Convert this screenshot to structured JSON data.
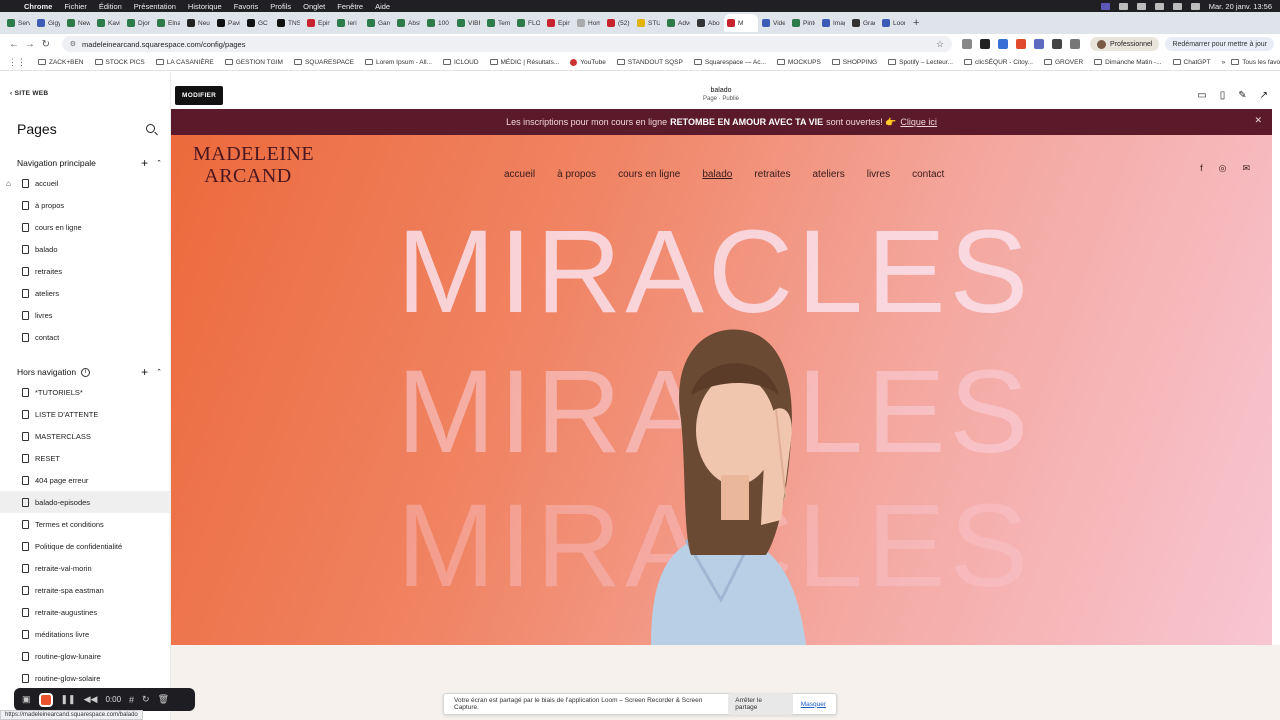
{
  "menubar": {
    "app": "Chrome",
    "items": [
      "Fichier",
      "Édition",
      "Présentation",
      "Historique",
      "Favoris",
      "Profils",
      "Onglet",
      "Fenêtre",
      "Aide"
    ],
    "clock": "Mar. 20 janv. 13:56"
  },
  "tabs": [
    {
      "label": "Servi",
      "color": "#2d7a4a"
    },
    {
      "label": "Gigy",
      "color": "#3b5bb5"
    },
    {
      "label": "New",
      "color": "#2d7a4a"
    },
    {
      "label": "Kavi",
      "color": "#2d7a4a"
    },
    {
      "label": "Djon",
      "color": "#2d7a4a"
    },
    {
      "label": "Elna",
      "color": "#2d7a4a"
    },
    {
      "label": "Neu",
      "color": "#222"
    },
    {
      "label": "Pavi",
      "color": "#111"
    },
    {
      "label": "GC",
      "color": "#111"
    },
    {
      "label": "TNS",
      "color": "#111"
    },
    {
      "label": "Épin",
      "color": "#c8232c"
    },
    {
      "label": "leri",
      "color": "#2d7a4a"
    },
    {
      "label": "Garc",
      "color": "#2d7a4a"
    },
    {
      "label": "Abst",
      "color": "#2d7a4a"
    },
    {
      "label": "100",
      "color": "#2d7a4a"
    },
    {
      "label": "VIBR",
      "color": "#2d7a4a"
    },
    {
      "label": "Tem",
      "color": "#2d7a4a"
    },
    {
      "label": "FLOI",
      "color": "#2d7a4a"
    },
    {
      "label": "Épin",
      "color": "#c8232c"
    },
    {
      "label": "Hom",
      "color": "#aaa"
    },
    {
      "label": "(52)",
      "color": "#c8232c"
    },
    {
      "label": "STU",
      "color": "#e0b400"
    },
    {
      "label": "Adve",
      "color": "#2d7a4a"
    },
    {
      "label": "Abo",
      "color": "#333"
    },
    {
      "label": "M",
      "color": "#c8232c",
      "active": true
    },
    {
      "label": "Vide",
      "color": "#3b5bb5"
    },
    {
      "label": "Pinte",
      "color": "#2d7a4a"
    },
    {
      "label": "Imag",
      "color": "#3b5bb5"
    },
    {
      "label": "Grad",
      "color": "#333"
    },
    {
      "label": "Loon",
      "color": "#3b5bb5"
    }
  ],
  "toolbar": {
    "url": "madeleinearcand.squarespace.com/config/pages",
    "profile_label": "Professionnel",
    "update_label": "Redémarrer pour mettre à jour"
  },
  "bookmarks": {
    "items": [
      "ZACK+BEN",
      "STOCK PICS",
      "LA CASANIÈRE",
      "GESTION TGIM",
      "SQUARESPACE",
      "Lorem Ipsum - All...",
      "ICLOUD",
      "MÉDIC | Résultats...",
      "YouTube",
      "STANDOUT SQSP",
      "Squarespace — Ac...",
      "MOCKUPS",
      "SHOPPING",
      "Spotify – Lecteur...",
      "clicSÉQUR - Citoy...",
      "GROVER",
      "Dimanche Matin -...",
      "ChatGPT"
    ],
    "all_label": "Tous les favoris"
  },
  "sidebar": {
    "back_label": "SITE WEB",
    "title": "Pages",
    "nav_section": "Navigation principale",
    "nav_pages": [
      "accueil",
      "à propos",
      "cours en ligne",
      "balado",
      "retraites",
      "ateliers",
      "livres",
      "contact"
    ],
    "off_section": "Hors navigation",
    "off_pages": [
      "*TUTORIELS*",
      "LISTE D'ATTENTE",
      "MASTERCLASS",
      "RESET",
      "404 page erreur",
      "balado-episodes",
      "Termes et conditions",
      "Politique de confidentialité",
      "retraite-val-morin",
      "retraite-spa eastman",
      "retraite-augustines",
      "méditations livre",
      "routine-glow-lunaire",
      "routine-glow-solaire"
    ],
    "selected": "balado-episodes"
  },
  "editor": {
    "modify_label": "MODIFIER",
    "page_name": "balado",
    "page_status": "Page · Publié"
  },
  "site": {
    "announcement_prefix": "Les inscriptions pour mon cours en ligne",
    "announcement_bold": "RETOMBE EN AMOUR AVEC TA VIE",
    "announcement_suffix": "sont ouvertes! 👉",
    "announcement_link": "Clique ici",
    "logo_line1": "MADELEINE",
    "logo_line2": "ARCAND",
    "nav": [
      "accueil",
      "à propos",
      "cours en ligne",
      "balado",
      "retraites",
      "ateliers",
      "livres",
      "contact"
    ],
    "current_nav": "balado",
    "hero_word": "MIRACLES"
  },
  "loom": {
    "timer": "0:00",
    "share_text": "Votre écran est partagé par le biais de l'application Loom – Screen Recorder & Screen Capture.",
    "stop_label": "Arrêter le partage",
    "hide_label": "Masquer"
  },
  "status_url": "https://madeleinearcand.squarespace.com/balado",
  "colors": {
    "announcement_bg": "#5a1a2a",
    "hero_start": "#ec6a3c",
    "hero_end": "#f8c6d3",
    "logo": "#4a1720"
  }
}
